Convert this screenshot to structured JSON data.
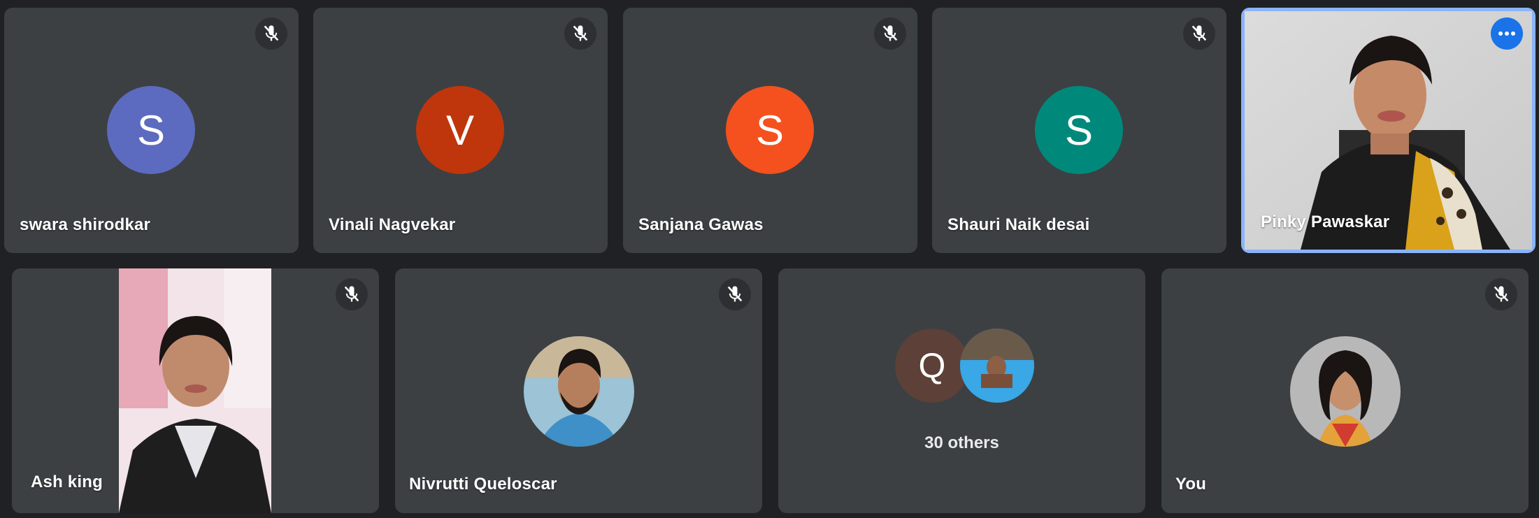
{
  "meeting": {
    "participants": [
      {
        "name": "swara shirodkar",
        "initial": "S",
        "avatar_color": "#5c6bc0",
        "muted": true
      },
      {
        "name": "Vinali Nagvekar",
        "initial": "V",
        "avatar_color": "#bf360c",
        "muted": true
      },
      {
        "name": "Sanjana Gawas",
        "initial": "S",
        "avatar_color": "#f4511e",
        "muted": true
      },
      {
        "name": "Shauri Naik desai",
        "initial": "S",
        "avatar_color": "#00897b",
        "muted": true
      },
      {
        "name": "Pinky Pawaskar",
        "video": true,
        "active_speaker": true
      },
      {
        "name": "Ash king",
        "video": true,
        "muted": true
      },
      {
        "name": "Nivrutti Queloscar",
        "photo": true,
        "muted": true
      },
      {
        "name": "You",
        "photo": true,
        "muted": true
      }
    ],
    "others": {
      "label": "30 others",
      "initial": "Q",
      "avatar_color": "#5d4037"
    }
  },
  "icons": {
    "muted": "mic-off-icon",
    "more": "more-options-icon"
  },
  "colors": {
    "background": "#202124",
    "tile": "#3c4043",
    "active_border": "#8ab4f8",
    "more_button": "#1a73e8"
  }
}
